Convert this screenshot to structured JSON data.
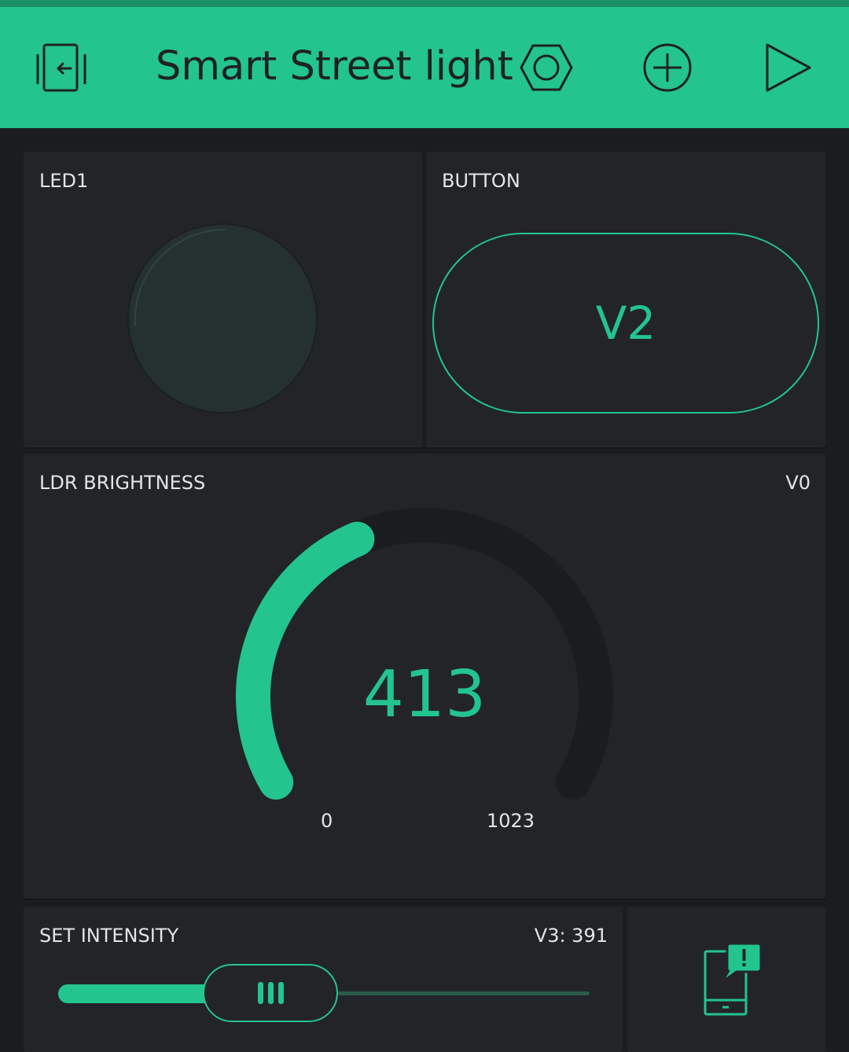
{
  "colors": {
    "accent": "#23c48e",
    "header_bg": "#23c48e",
    "panel_bg": "#232428",
    "page_bg": "#1b1c1f",
    "text": "#e3e5e8"
  },
  "header": {
    "title": "Smart Street light",
    "icons": [
      "exit-icon",
      "settings-hexagon-icon",
      "add-icon",
      "play-icon"
    ]
  },
  "led": {
    "label": "LED1",
    "state": "off"
  },
  "button": {
    "label": "BUTTON",
    "text": "V2"
  },
  "gauge": {
    "label": "LDR BRIGHTNESS",
    "pin": "V0",
    "value": "413",
    "min": "0",
    "max": "1023",
    "value_num": 413,
    "min_num": 0,
    "max_num": 1023
  },
  "slider": {
    "label": "SET INTENSITY",
    "pin_value": "V3: 391",
    "fill_fraction": 0.38
  },
  "notification": {
    "icon": "phone-notification-icon"
  }
}
